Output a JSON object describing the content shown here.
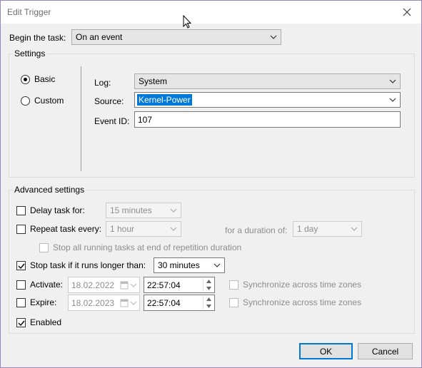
{
  "window": {
    "title": "Edit Trigger"
  },
  "begin": {
    "label": "Begin the task:",
    "value": "On an event"
  },
  "settings": {
    "group_label": "Settings",
    "basic_label": "Basic",
    "custom_label": "Custom",
    "log_label": "Log:",
    "log_value": "System",
    "source_label": "Source:",
    "source_value": "Kernel-Power",
    "eventid_label": "Event ID:",
    "eventid_value": "107"
  },
  "advanced": {
    "group_label": "Advanced settings",
    "delay_label": "Delay task for:",
    "delay_value": "15 minutes",
    "repeat_label": "Repeat task every:",
    "repeat_value": "1 hour",
    "duration_label": "for a duration of:",
    "duration_value": "1 day",
    "stop_all_label": "Stop all running tasks at end of repetition duration",
    "stop_longer_label": "Stop task if it runs longer than:",
    "stop_longer_value": "30 minutes",
    "activate_label": "Activate:",
    "activate_date": "18.02.2022",
    "activate_time": "22:57:04",
    "expire_label": "Expire:",
    "expire_date": "18.02.2023",
    "expire_time": "22:57:04",
    "sync_label": "Synchronize across time zones",
    "enabled_label": "Enabled"
  },
  "buttons": {
    "ok": "OK",
    "cancel": "Cancel"
  },
  "colors": {
    "accent": "#0078d7",
    "selection": "#0078d7"
  }
}
